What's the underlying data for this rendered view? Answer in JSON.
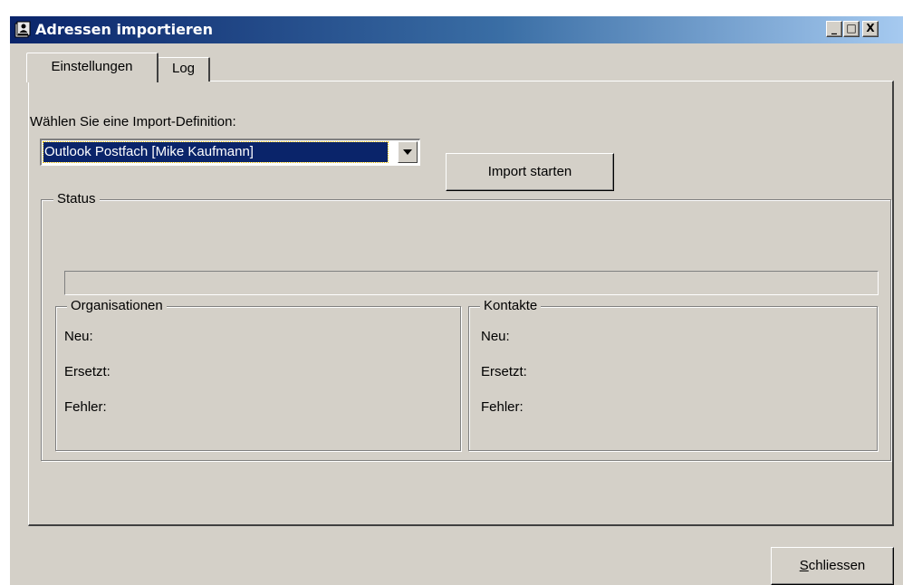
{
  "window": {
    "title": "Adressen importieren",
    "title_icon": "address-book-icon",
    "minimize_label": "_",
    "maximize_label": "□",
    "close_label": "X"
  },
  "tabs": [
    {
      "label": "Einstellungen",
      "active": true
    },
    {
      "label": "Log",
      "active": false
    }
  ],
  "settings": {
    "definition_label": "Wählen Sie eine Import-Definition:",
    "definition_value": "Outlook Postfach [Mike Kaufmann]",
    "import_button": "Import starten"
  },
  "status": {
    "title": "Status",
    "progress": 0,
    "organisations": {
      "title": "Organisationen",
      "new_label": "Neu:",
      "replaced_label": "Ersetzt:",
      "errors_label": "Fehler:"
    },
    "contacts": {
      "title": "Kontakte",
      "new_label": "Neu:",
      "replaced_label": "Ersetzt:",
      "errors_label": "Fehler:"
    }
  },
  "footer": {
    "close_button_accel": "S",
    "close_button_rest": "chliessen"
  },
  "colors": {
    "titlebar_start": "#0a246a",
    "titlebar_end": "#a6caf0",
    "selection": "#0a246a",
    "face": "#d4d0c8"
  }
}
